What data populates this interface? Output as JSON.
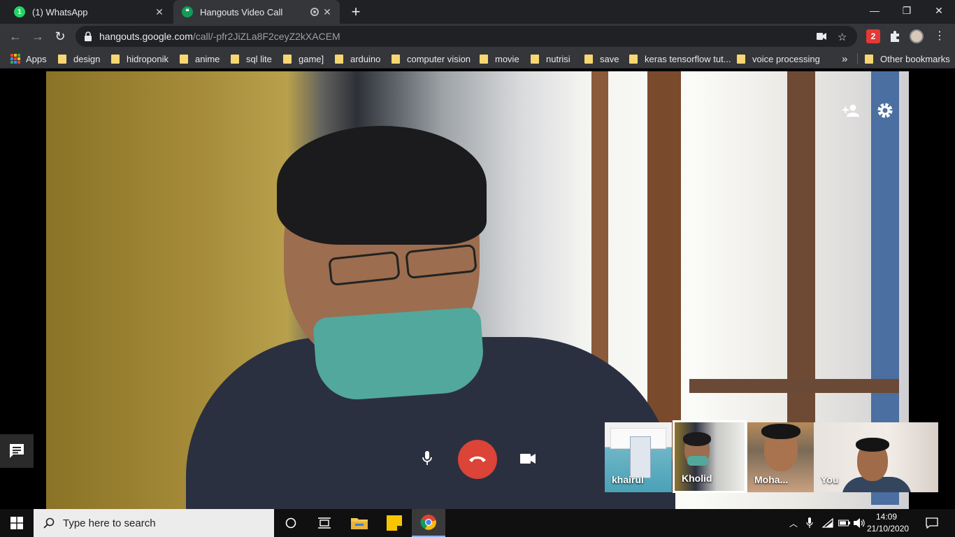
{
  "browser": {
    "tabs": [
      {
        "title": "(1) WhatsApp",
        "favicon": "whatsapp-icon",
        "active": false
      },
      {
        "title": "Hangouts Video Call",
        "favicon": "hangouts-icon",
        "active": true
      }
    ],
    "url_host": "hangouts.google.com",
    "url_path": "/call/-pfr2JiZLa8F2ceyZ2kXACEM",
    "bookmarks": [
      "Apps",
      "design",
      "hidroponik",
      "anime",
      "sql lite",
      "game]",
      "arduino",
      "computer vision",
      "movie",
      "nutrisi",
      "save",
      "keras tensorflow tut...",
      "voice processing"
    ],
    "bookmark_overflow": "»",
    "other_bookmarks": "Other bookmarks"
  },
  "call": {
    "participants": [
      {
        "name": "khairul"
      },
      {
        "name": "Kholid",
        "selected": true
      },
      {
        "name": "Moha..."
      },
      {
        "name": "You"
      }
    ],
    "hangup_color": "#db4437"
  },
  "taskbar": {
    "search_placeholder": "Type here to search",
    "time": "14:09",
    "date": "21/10/2020"
  }
}
